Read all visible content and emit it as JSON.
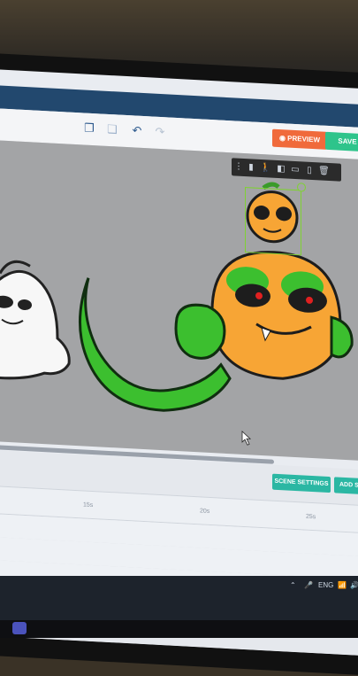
{
  "toolbar": {
    "preview_label": "PREVIEW",
    "save_label": "SAVE",
    "icons": [
      "copy-icon",
      "duplicate-icon",
      "undo-icon",
      "redo-icon"
    ]
  },
  "canvas": {
    "floating_toolbar_icons": [
      "grip-icon",
      "layer-icon",
      "walk-action-icon",
      "flip-icon",
      "copy-icon",
      "paste-icon",
      "delete-icon"
    ]
  },
  "panel": {
    "scene_settings_label": "SCENE SETTINGS",
    "add_scene_label": "ADD S",
    "ruler_ticks": [
      "15s",
      "20s",
      "25s"
    ]
  },
  "taskbar": {
    "language": "ENG"
  },
  "colors": {
    "topbar": "#22486e",
    "preview": "#f06a3b",
    "save": "#2ec48b",
    "scene_button": "#2bb7a3",
    "selection": "#7fd232"
  }
}
